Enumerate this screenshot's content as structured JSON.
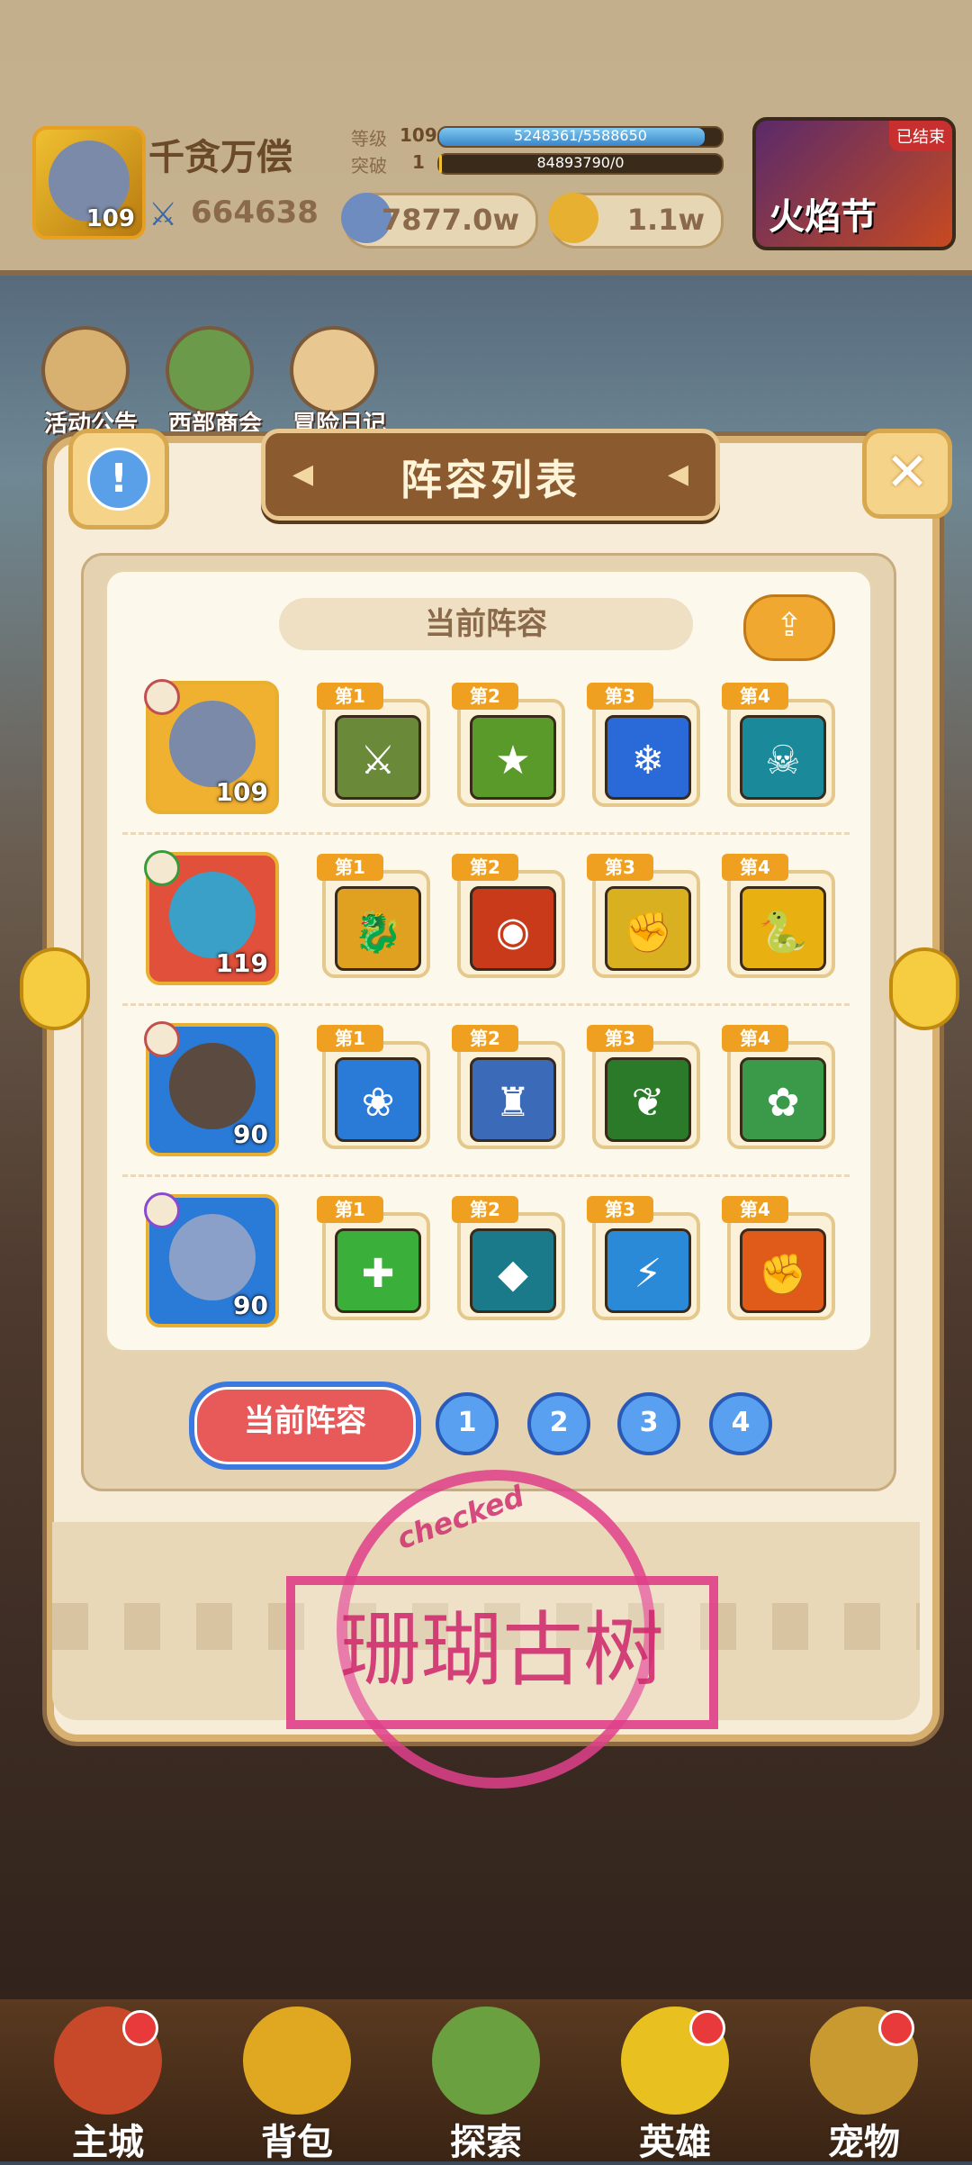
{
  "player": {
    "name": "千贪万偿",
    "level": "109",
    "power": "664638",
    "stats": [
      {
        "label": "等级",
        "value": "109",
        "bar_text": "5248361/5588650",
        "progress": 0.94
      },
      {
        "label": "突破",
        "value": "1",
        "bar_text": "84893790/0",
        "progress": 0.01
      }
    ],
    "currencies": [
      {
        "icon": "coin-icon",
        "value": "7877.0w",
        "color": "#6f8cc0"
      },
      {
        "icon": "gold-clover-icon",
        "value": "1.1w",
        "color": "#e8b030"
      }
    ]
  },
  "festival": {
    "label": "火焰节",
    "tag": "已结束"
  },
  "shortcuts": [
    {
      "label": "活动公告",
      "icon": "notice-board-icon"
    },
    {
      "label": "西部商会",
      "icon": "merchant-icon"
    },
    {
      "label": "冒险日记",
      "icon": "diary-icon"
    }
  ],
  "panel": {
    "title": "阵容列表",
    "current_label": "当前阵容",
    "info_glyph": "!",
    "close_glyph": "✕",
    "share_glyph": "⇪"
  },
  "lineup": [
    {
      "level": "109",
      "hero_color": "#f0b030",
      "face": "#7a8aa8",
      "badge": "#c05050",
      "skills": [
        {
          "tag": "第1",
          "bg": "#6a8a3a",
          "glyph": "⚔"
        },
        {
          "tag": "第2",
          "bg": "#5a9a2a",
          "glyph": "★"
        },
        {
          "tag": "第3",
          "bg": "#2a6ad8",
          "glyph": "❄"
        },
        {
          "tag": "第4",
          "bg": "#1a8a9a",
          "glyph": "☠"
        }
      ]
    },
    {
      "level": "119",
      "hero_color": "#e0503a",
      "face": "#3aa0c8",
      "badge": "#3a9a3a",
      "skills": [
        {
          "tag": "第1",
          "bg": "#e0a020",
          "glyph": "🐉"
        },
        {
          "tag": "第2",
          "bg": "#c83a1a",
          "glyph": "◉"
        },
        {
          "tag": "第3",
          "bg": "#d8b020",
          "glyph": "✊"
        },
        {
          "tag": "第4",
          "bg": "#e8b010",
          "glyph": "🐍"
        }
      ]
    },
    {
      "level": "90",
      "hero_color": "#2a7ad8",
      "face": "#5a4a40",
      "badge": "#c05050",
      "skills": [
        {
          "tag": "第1",
          "bg": "#2a7ad8",
          "glyph": "❀"
        },
        {
          "tag": "第2",
          "bg": "#3a6ab8",
          "glyph": "♜"
        },
        {
          "tag": "第3",
          "bg": "#2a7a2a",
          "glyph": "❦"
        },
        {
          "tag": "第4",
          "bg": "#3a9a4a",
          "glyph": "✿"
        }
      ]
    },
    {
      "level": "90",
      "hero_color": "#2a7ad8",
      "face": "#8aa0c8",
      "badge": "#8a4ad0",
      "skills": [
        {
          "tag": "第1",
          "bg": "#3ab03a",
          "glyph": "✚"
        },
        {
          "tag": "第2",
          "bg": "#1a7a8a",
          "glyph": "◆"
        },
        {
          "tag": "第3",
          "bg": "#2a8ad8",
          "glyph": "⚡"
        },
        {
          "tag": "第4",
          "bg": "#e05a1a",
          "glyph": "✊"
        }
      ]
    }
  ],
  "tabs": {
    "current": "当前阵容",
    "numbers": [
      "1",
      "2",
      "3",
      "4"
    ]
  },
  "stamp": {
    "text": "珊瑚古树",
    "ring_word": "checked"
  },
  "bottom_nav": [
    {
      "label": "主城",
      "icon": "castle-icon",
      "color": "#c8482a",
      "dot": true
    },
    {
      "label": "背包",
      "icon": "backpack-icon",
      "color": "#e0a820",
      "dot": false
    },
    {
      "label": "探索",
      "icon": "map-icon",
      "color": "#6aa040",
      "dot": false
    },
    {
      "label": "英雄",
      "icon": "hero-icon",
      "color": "#e8c020",
      "dot": true
    },
    {
      "label": "宠物",
      "icon": "pet-icon",
      "color": "#c89a30",
      "dot": true
    }
  ]
}
